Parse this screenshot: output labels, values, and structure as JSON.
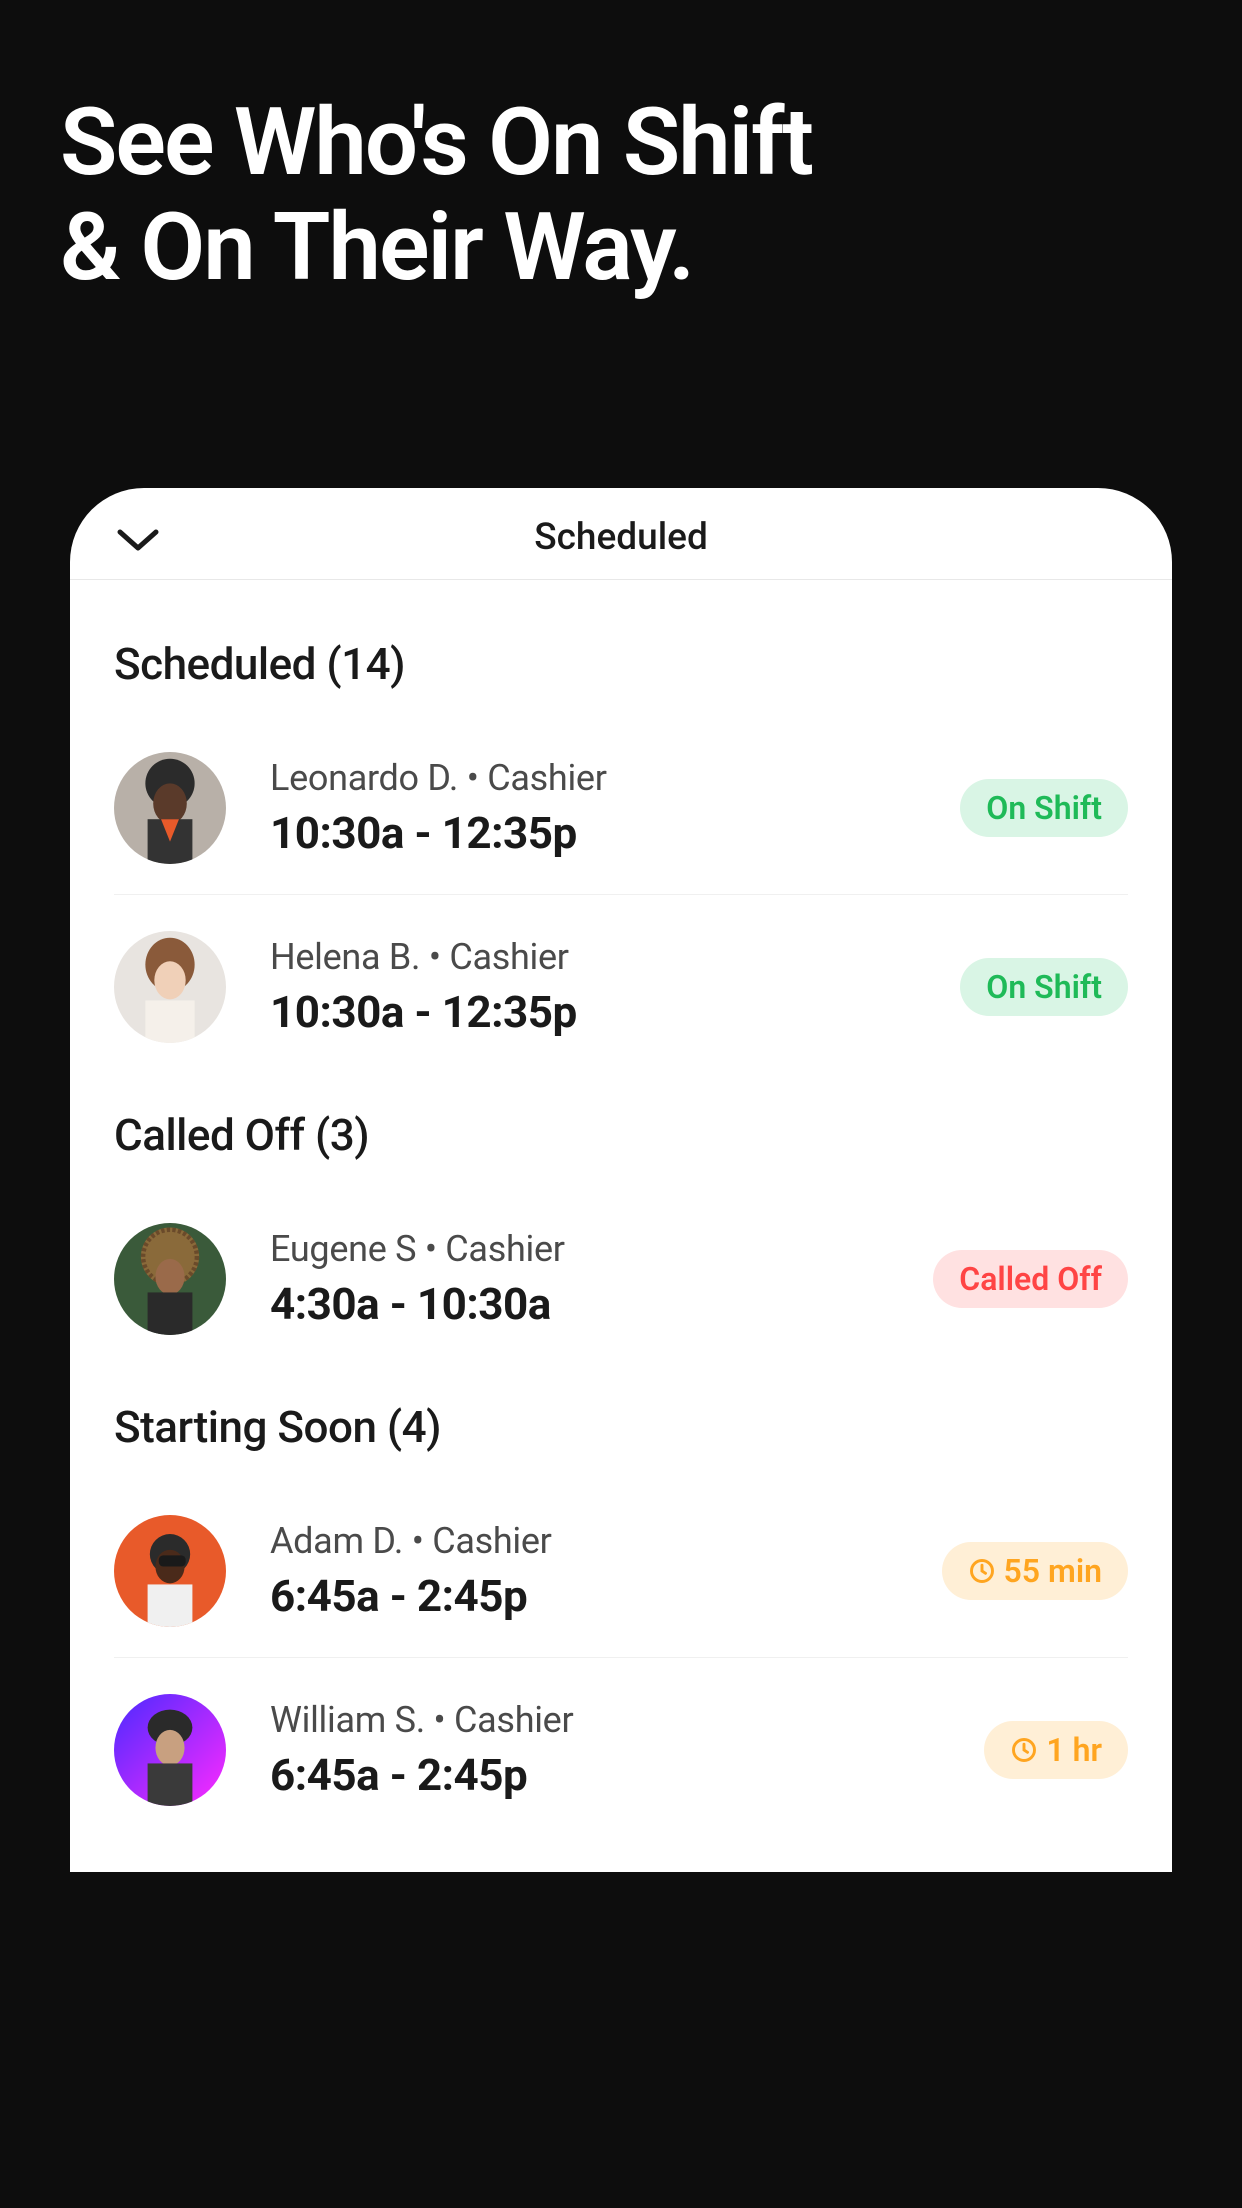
{
  "hero": {
    "line1": "See Who's On Shift",
    "line2": "& On Their Way."
  },
  "header": {
    "title": "Scheduled"
  },
  "sections": {
    "scheduled": {
      "label": "Scheduled (14)"
    },
    "calledoff": {
      "label": "Called Off (3)"
    },
    "startingsoon": {
      "label": "Starting Soon (4)"
    }
  },
  "shifts": {
    "0": {
      "name": "Leonardo D. • Cashier",
      "time": "10:30a - 12:35p",
      "badge": "On Shift"
    },
    "1": {
      "name": "Helena B. • Cashier",
      "time": "10:30a - 12:35p",
      "badge": "On Shift"
    },
    "2": {
      "name": "Eugene S • Cashier",
      "time": "4:30a - 10:30a",
      "badge": "Called Off"
    },
    "3": {
      "name": "Adam D. • Cashier",
      "time": "6:45a - 2:45p",
      "badge": "55 min"
    },
    "4": {
      "name": "William S. • Cashier",
      "time": "6:45a - 2:45p",
      "badge": "1 hr"
    }
  },
  "colors": {
    "green": "#1fba58",
    "greenBg": "#d9f5e5",
    "red": "#ff4444",
    "redBg": "#ffe1e1",
    "orange": "#ffa520",
    "orangeBg": "#ffefd6"
  }
}
